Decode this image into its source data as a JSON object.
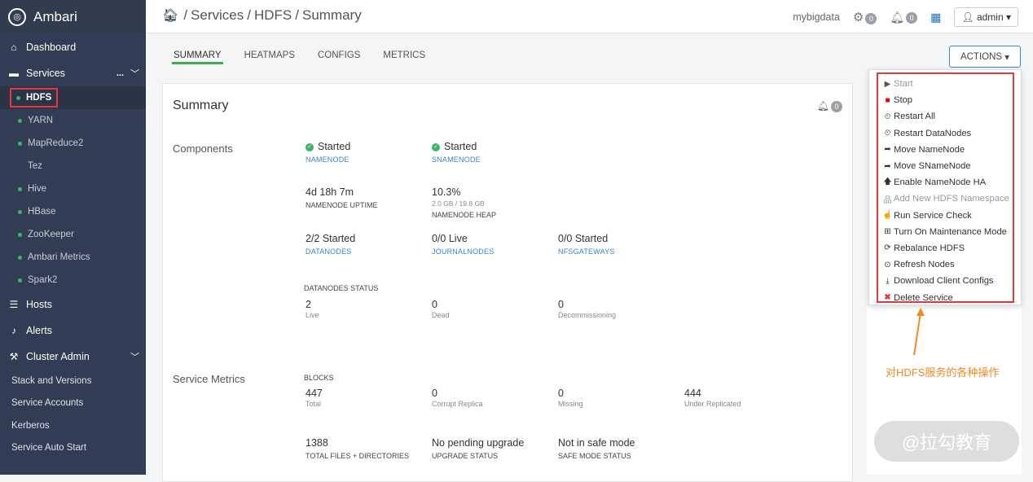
{
  "app": {
    "title": "Ambari"
  },
  "sidebar": {
    "dashboard": "Dashboard",
    "services": "Services",
    "services_more": "...",
    "service_items": [
      "HDFS",
      "YARN",
      "MapReduce2",
      "Tez",
      "Hive",
      "HBase",
      "ZooKeeper",
      "Ambari Metrics",
      "Spark2"
    ],
    "hosts": "Hosts",
    "alerts": "Alerts",
    "cluster_admin": "Cluster Admin",
    "admin_items": [
      "Stack and Versions",
      "Service Accounts",
      "Kerberos",
      "Service Auto Start"
    ]
  },
  "breadcrumb": {
    "services": "Services",
    "sep": "/",
    "hdfs": "HDFS",
    "summary": "Summary"
  },
  "topbar": {
    "cluster": "mybigdata",
    "ops_count": "0",
    "alerts_count": "0",
    "user": "admin"
  },
  "tabs": [
    "SUMMARY",
    "HEATMAPS",
    "CONFIGS",
    "METRICS"
  ],
  "actions_label": "ACTIONS",
  "summary": {
    "title": "Summary",
    "bell_count": "0",
    "components_label": "Components",
    "namenode_status": "Started",
    "namenode_link": "NAMENODE",
    "snamenode_status": "Started",
    "snamenode_link": "SNAMENODE",
    "uptime_value": "4d 18h 7m",
    "uptime_label": "NAMENODE UPTIME",
    "heap_value": "10.3%",
    "heap_sub": "2.0 GB / 19.8 GB",
    "heap_label": "NAMENODE HEAP",
    "datanodes_value": "2/2 Started",
    "datanodes_link": "DATANODES",
    "journal_value": "0/0 Live",
    "journal_link": "JOURNALNODES",
    "nfs_value": "0/0 Started",
    "nfs_link": "NFSGATEWAYS",
    "dn_status_label": "DATANODES STATUS",
    "live_value": "2",
    "live_label": "Live",
    "dead_value": "0",
    "dead_label": "Dead",
    "decom_value": "0",
    "decom_label": "Decommissioning",
    "metrics_label": "Service Metrics",
    "blocks_label": "BLOCKS",
    "total_value": "447",
    "total_label": "Total",
    "corrupt_value": "0",
    "corrupt_label": "Corrupt Replica",
    "missing_value": "0",
    "missing_label": "Missing",
    "under_value": "444",
    "under_label": "Under Replicated",
    "files_value": "1388",
    "files_label": "TOTAL FILES + DIRECTORIES",
    "upgrade_value": "No pending upgrade",
    "upgrade_label": "UPGRADE STATUS",
    "safemode_value": "Not in safe mode",
    "safemode_label": "SAFE MODE STATUS"
  },
  "menu": [
    {
      "label": "Start",
      "icon": "play-icon"
    },
    {
      "label": "Stop",
      "icon": "stop-icon"
    },
    {
      "label": "Restart All",
      "icon": "restart-icon"
    },
    {
      "label": "Restart DataNodes",
      "icon": "restart-icon"
    },
    {
      "label": "Move NameNode",
      "icon": "share-arrow-icon"
    },
    {
      "label": "Move SNameNode",
      "icon": "share-arrow-icon"
    },
    {
      "label": "Enable NameNode HA",
      "icon": "arrow-up-icon"
    },
    {
      "label": "Add New HDFS Namespace",
      "icon": "sitemap-icon"
    },
    {
      "label": "Run Service Check",
      "icon": "thumbs-up-icon"
    },
    {
      "label": "Turn On Maintenance Mode",
      "icon": "medkit-icon"
    },
    {
      "label": "Rebalance HDFS",
      "icon": "refresh-icon"
    },
    {
      "label": "Refresh Nodes",
      "icon": "circle-arrow-icon"
    },
    {
      "label": "Download Client Configs",
      "icon": "download-icon"
    },
    {
      "label": "Delete Service",
      "icon": "delete-icon"
    }
  ],
  "annotation": "对HDFS服务的各种操作",
  "watermark": "@拉勾教育",
  "colors": {
    "sidebar": "#313d54",
    "accent": "#3fae49",
    "highlight": "#e4393c",
    "annotation": "#f08a24",
    "link": "#3a86c8"
  }
}
